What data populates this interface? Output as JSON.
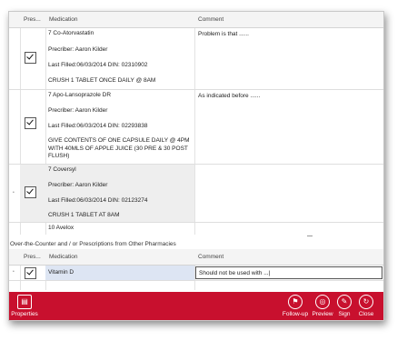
{
  "columns": {
    "prescribed": "Pres...",
    "medication": "Medication",
    "comment": "Comment"
  },
  "rx_rows": [
    {
      "name": "7 Co-Atorvastatin",
      "prescriber": "Precriber: Aaron Kilder",
      "filled": "Last Filled:06/03/2014 DIN: 02310902",
      "instructions": "CRUSH 1 TABLET ONCE DAILY  @ 8AM",
      "comment": "Problem is that ......"
    },
    {
      "name": "7 Apo-Lansoprazole DR",
      "prescriber": "Precriber: Aaron Kilder",
      "filled": "Last Filled:06/03/2014 DIN: 02293838",
      "instructions": "GIVE CONTENTS OF ONE CAPSULE DAILY @ 4PM WITH 40MLS OF APPLE JUICE (30 PRE & 30 POST FLUSH)",
      "comment": "As indicated before ......"
    },
    {
      "name": "7 Coversyl",
      "prescriber": "Precriber: Aaron Kilder",
      "filled": "Last Filled:06/03/2014 DIN: 02123274",
      "instructions": "CRUSH 1 TABLET AT 8AM",
      "comment": ""
    },
    {
      "name": "10 Avelox"
    }
  ],
  "otc_section_label": "Over-the-Counter and  / or Prescriptions from Other Pharmacies",
  "otc_rows": [
    {
      "name": "Vitamin D",
      "comment": "Should not be used with ...|"
    }
  ],
  "toolbar": {
    "properties": "Properties",
    "follow_up": "Follow-up",
    "preview": "Preview",
    "sign": "Sign",
    "close": "Close"
  },
  "colors": {
    "toolbar_bg": "#c8102e",
    "selected_row": "#eeeeee",
    "otc_row_highlight": "#dde5f3"
  },
  "icons": [
    "properties-icon",
    "follow-up-icon",
    "preview-icon",
    "sign-icon",
    "close-icon",
    "checkmark-icon",
    "row-marker-icon"
  ]
}
